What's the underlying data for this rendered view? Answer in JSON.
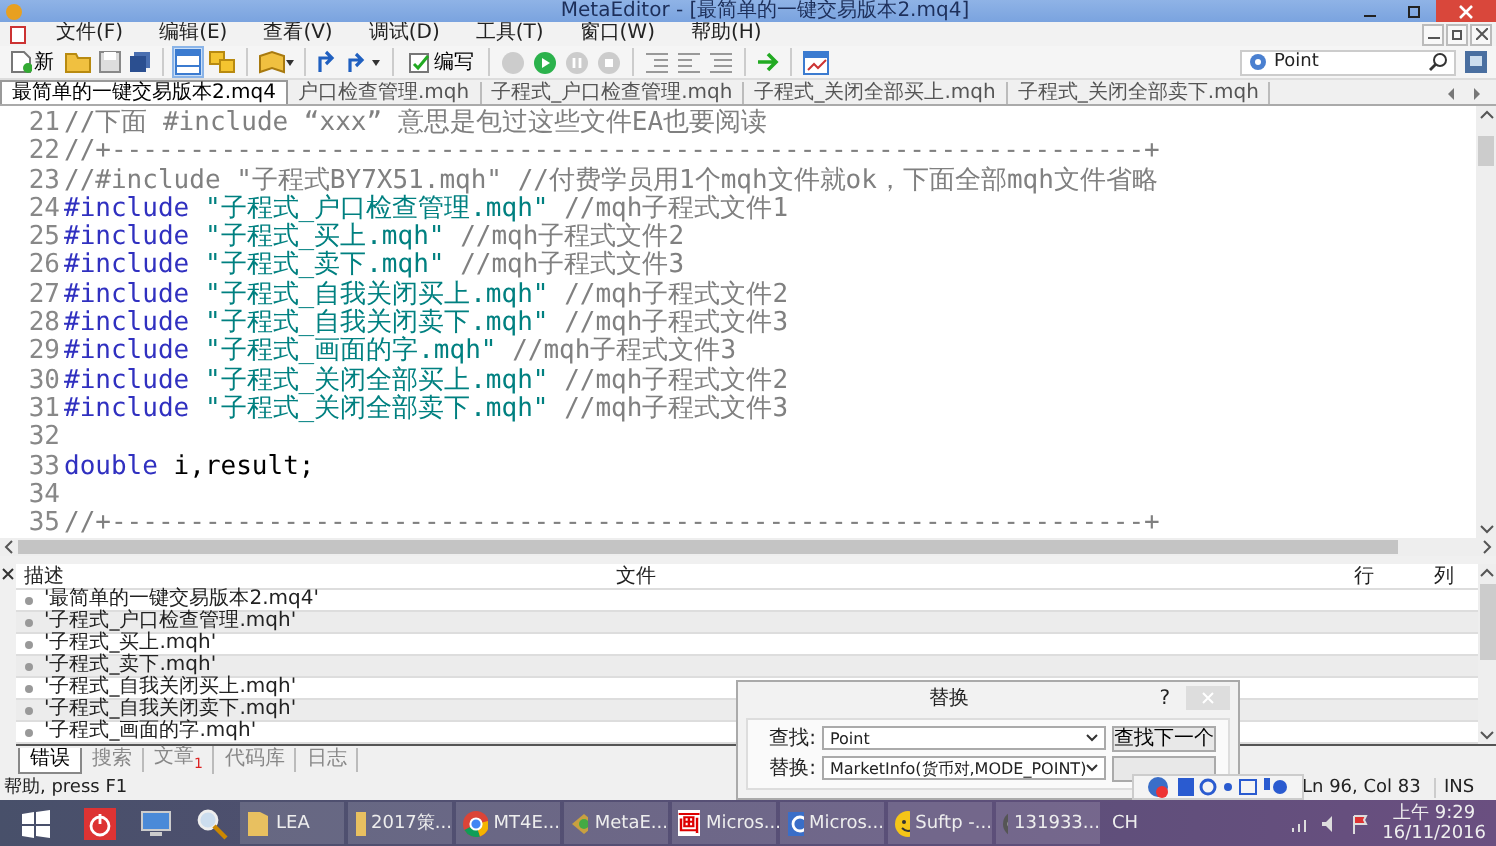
{
  "window": {
    "title": "MetaEditor - [最简单的一键交易版本2.mq4]"
  },
  "menu": [
    "文件(F)",
    "编辑(E)",
    "查看(V)",
    "调试(D)",
    "工具(T)",
    "窗口(W)",
    "帮助(H)"
  ],
  "toolbar": {
    "new_label": "新",
    "compile_label": "编写",
    "search": {
      "value": "Point"
    }
  },
  "tabs": [
    {
      "label": "最简单的一键交易版本2.mq4",
      "selected": true
    },
    {
      "label": "户口检查管理.mqh",
      "selected": false
    },
    {
      "label": "子程式_户口检查管理.mqh",
      "selected": false
    },
    {
      "label": "子程式_关闭全部买上.mqh",
      "selected": false
    },
    {
      "label": "子程式_关闭全部卖下.mqh",
      "selected": false
    }
  ],
  "editor": {
    "lines": [
      {
        "number": "21",
        "tokens": [
          {
            "kind": "comment",
            "text": "//下面 #include “xxx” 意思是包过这些文件EA也要阅读"
          }
        ]
      },
      {
        "number": "22",
        "tokens": [
          {
            "kind": "comment",
            "text": "//+------------------------------------------------------------------+"
          }
        ]
      },
      {
        "number": "23",
        "tokens": [
          {
            "kind": "comment",
            "text": "//#include \"子程式BY7X51.mqh\" //付费学员用1个mqh文件就ok，下面全部mqh文件省略"
          }
        ]
      },
      {
        "number": "24",
        "tokens": [
          {
            "kind": "keyword",
            "text": "#include"
          },
          {
            "kind": "string",
            "text": "\"子程式_户口检查管理.mqh\""
          },
          {
            "kind": "comment",
            "text": " //mqh子程式文件1"
          }
        ]
      },
      {
        "number": "25",
        "tokens": [
          {
            "kind": "keyword",
            "text": "#include"
          },
          {
            "kind": "string",
            "text": "\"子程式_买上.mqh\""
          },
          {
            "kind": "comment",
            "text": " //mqh子程式文件2"
          }
        ]
      },
      {
        "number": "26",
        "tokens": [
          {
            "kind": "keyword",
            "text": "#include"
          },
          {
            "kind": "string",
            "text": "\"子程式_卖下.mqh\""
          },
          {
            "kind": "comment",
            "text": " //mqh子程式文件3"
          }
        ]
      },
      {
        "number": "27",
        "tokens": [
          {
            "kind": "keyword",
            "text": "#include"
          },
          {
            "kind": "string",
            "text": "\"子程式_自我关闭买上.mqh\""
          },
          {
            "kind": "comment",
            "text": " //mqh子程式文件2"
          }
        ]
      },
      {
        "number": "28",
        "tokens": [
          {
            "kind": "keyword",
            "text": "#include"
          },
          {
            "kind": "string",
            "text": "\"子程式_自我关闭卖下.mqh\""
          },
          {
            "kind": "comment",
            "text": " //mqh子程式文件3"
          }
        ]
      },
      {
        "number": "29",
        "tokens": [
          {
            "kind": "keyword",
            "text": "#include"
          },
          {
            "kind": "string",
            "text": "\"子程式_画面的字.mqh\""
          },
          {
            "kind": "comment",
            "text": " //mqh子程式文件3"
          }
        ]
      },
      {
        "number": "30",
        "tokens": [
          {
            "kind": "keyword",
            "text": "#include"
          },
          {
            "kind": "string",
            "text": "\"子程式_关闭全部买上.mqh\""
          },
          {
            "kind": "comment",
            "text": " //mqh子程式文件2"
          }
        ]
      },
      {
        "number": "31",
        "tokens": [
          {
            "kind": "keyword",
            "text": "#include"
          },
          {
            "kind": "string",
            "text": "\"子程式_关闭全部卖下.mqh\""
          },
          {
            "kind": "comment",
            "text": " //mqh子程式文件3"
          }
        ]
      },
      {
        "number": "32"
      },
      {
        "number": "33",
        "tokens": [
          {
            "kind": "keyword",
            "text": "double"
          },
          {
            "kind": "plain",
            "text": " i,result;"
          }
        ]
      },
      {
        "number": "34"
      },
      {
        "number": "35",
        "tokens": [
          {
            "kind": "comment",
            "text": "//+------------------------------------------------------------------+"
          }
        ]
      }
    ]
  },
  "output": {
    "columns": [
      "描述",
      "文件",
      "行",
      "列"
    ],
    "rows": [
      "'最简单的一键交易版本2.mq4'",
      "'子程式_户口检查管理.mqh'",
      "'子程式_买上.mqh'",
      "'子程式_卖下.mqh'",
      "'子程式_自我关闭买上.mqh'",
      "'子程式_自我关闭卖下.mqh'",
      "'子程式_画面的字.mqh'"
    ],
    "tabs": [
      {
        "label": "错误",
        "selected": true
      },
      {
        "label": "搜索",
        "selected": false
      },
      {
        "label": "文章",
        "selected": false,
        "badge": "1"
      },
      {
        "label": "代码库",
        "selected": false
      },
      {
        "label": "日志",
        "selected": false
      }
    ]
  },
  "replace_dialog": {
    "title": "替换",
    "help": "?",
    "find_label": "查找:",
    "find_value": "Point",
    "replace_label": "替换:",
    "replace_value": "MarketInfo(货币对,MODE_POINT)",
    "find_next": "查找下一个"
  },
  "status_bar": {
    "help": "帮助, press F1",
    "position": "Ln 96, Col 83",
    "mode": "INS"
  },
  "taskbar": {
    "items": [
      {
        "kind": "power"
      },
      {
        "kind": "computer"
      },
      {
        "kind": "magnifier"
      },
      {
        "kind": "folder",
        "label": "LEA"
      },
      {
        "kind": "folder",
        "label": "2017策..."
      },
      {
        "kind": "chrome",
        "label": "MT4E..."
      },
      {
        "kind": "editor",
        "label": "MetaE..."
      },
      {
        "kind": "glyph",
        "icon_text": "画",
        "label": "Micros..."
      },
      {
        "kind": "app",
        "label": "Micros..."
      },
      {
        "kind": "smiley",
        "label": "Suftp -..."
      },
      {
        "kind": "g",
        "label": "131933..."
      }
    ],
    "tray": {
      "lang": "CH",
      "time": "上午 9:29",
      "date": "16/11/2016"
    }
  }
}
